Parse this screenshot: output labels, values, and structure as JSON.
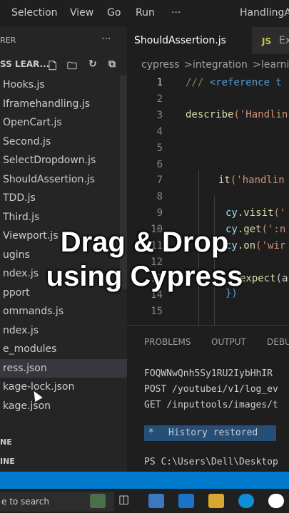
{
  "menu": {
    "selection": "Selection",
    "view": "View",
    "go": "Go",
    "run": "Run",
    "more": "···",
    "window_title": "HandlingA"
  },
  "explorer": {
    "header": "RER",
    "more": "···",
    "project": "SS LEAR...",
    "items": [
      "Hooks.js",
      "Iframehandling.js",
      "OpenCart.js",
      "Second.js",
      "SelectDropdown.js",
      "ShouldAssertion.js",
      "TDD.js",
      "Third.js",
      "Viewport.js",
      "ugins",
      "ndex.js",
      "pport",
      "ommands.js",
      "ndex.js",
      "e_modules",
      "ress.json",
      "kage-lock.json",
      "kage.json"
    ],
    "selected_index": 15
  },
  "tabs": {
    "active": "ShouldAssertion.js",
    "inactive_prefix": "JS",
    "inactive": "Ex"
  },
  "breadcrumb": {
    "part1": "cypress",
    "sep1": ">",
    "part2": "integration",
    "sep2": ">",
    "part3": "learni"
  },
  "editor": {
    "line_numbers": [
      "1",
      "2",
      "3",
      "4",
      "5",
      "6",
      "7",
      "8",
      "9",
      "10",
      "11",
      "12",
      "13",
      "14",
      "15"
    ],
    "lines": {
      "l1_slashes": "/// ",
      "l1_ref": "<reference t",
      "l3_fn": "describe",
      "l3_rest": "('Handlin",
      "l7_fn": "it",
      "l7_rest": "('handlin",
      "l9_var": "cy",
      "l9_fn": ".visit",
      "l9_rest": "('",
      "l10_var": "cy",
      "l10_fn": ".get",
      "l10_rest": "(':n",
      "l11_var": "cy",
      "l11_fn": ".on",
      "l11_rest": "('wir",
      "l12_fn": "expect",
      "l12_rest": "(a",
      "l13_close": "})"
    }
  },
  "panel": {
    "tabs": [
      "PROBLEMS",
      "OUTPUT",
      "DEBU"
    ],
    "terminal_lines": [
      "FOQWNwQnh5Sy1RU2IybHhIR",
      "POST /youtubei/v1/log_ev",
      "GET /inputtools/images/t"
    ],
    "history_star": "*",
    "history": "History restored",
    "prompt": "PS C:\\Users\\Dell\\Desktop"
  },
  "outline": {
    "line1": "NE",
    "line2": "INE"
  },
  "taskbar": {
    "search": "e to search"
  },
  "overlay": {
    "line1": "Drag & Drop",
    "line2": "using Cypress"
  },
  "colors": {
    "accent": "#007acc",
    "selection": "#37373d",
    "history_bg": "#264f78"
  }
}
